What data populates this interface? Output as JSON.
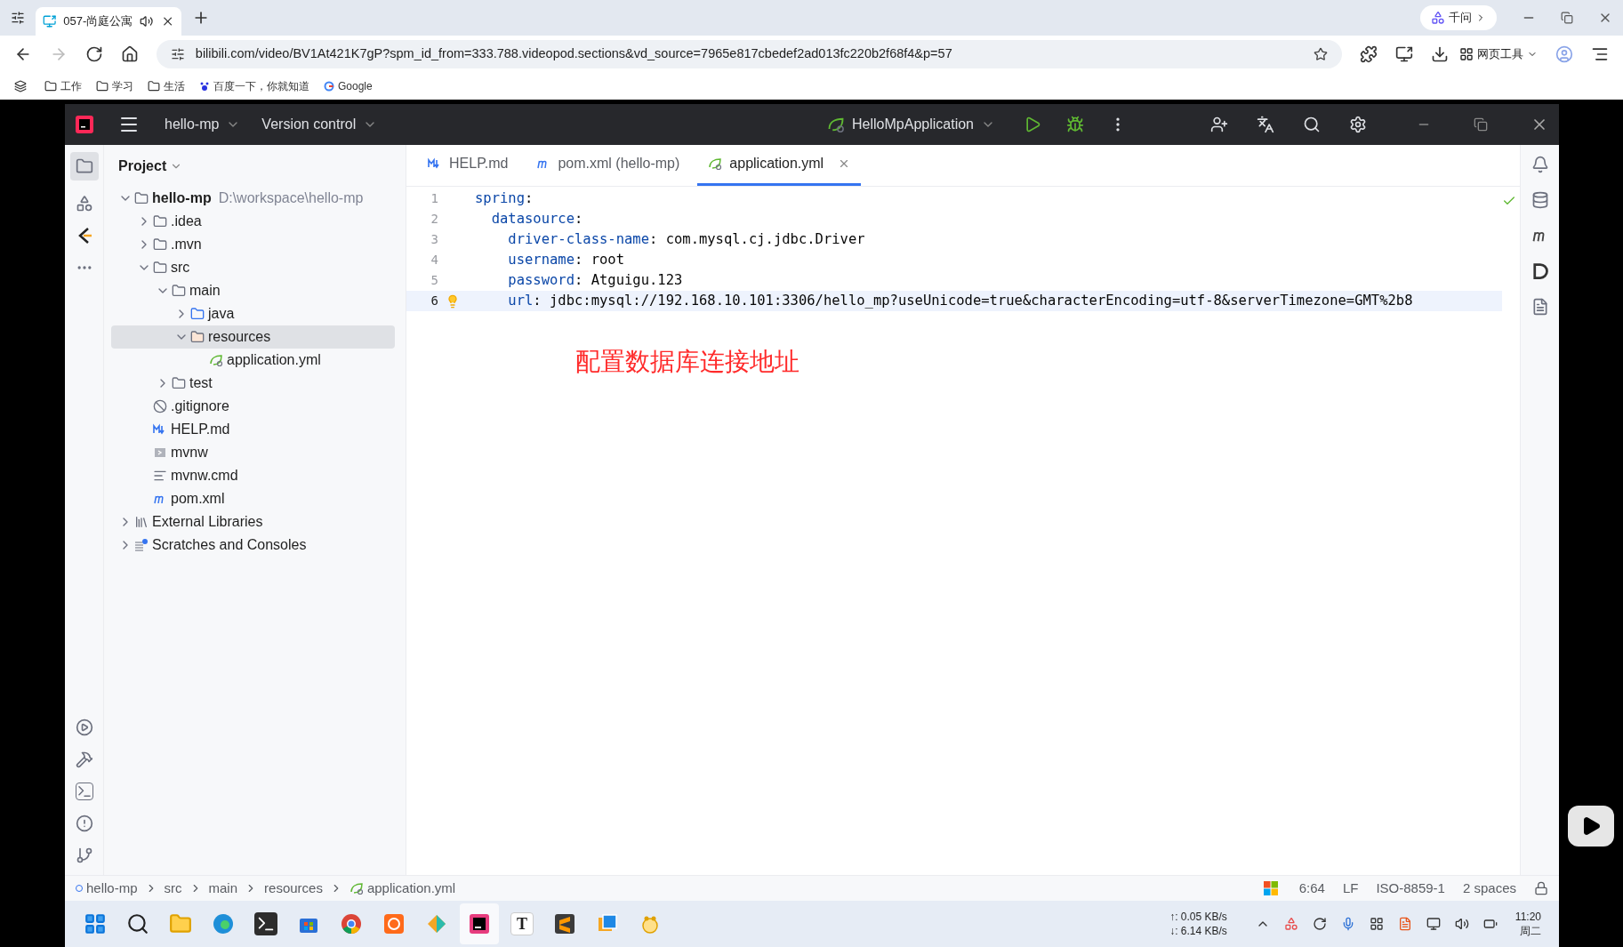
{
  "browser": {
    "tab": {
      "title": "057-尚庭公寓"
    },
    "url": "bilibili.com/video/BV1At421K7gP?spm_id_from=333.788.videopod.sections&vd_source=7965e817cbedef2ad013fc220b2f68f4&p=57",
    "assistant": "千问",
    "tools": "网页工具",
    "bookmarks": [
      {
        "label": "工作",
        "kind": "folder"
      },
      {
        "label": "学习",
        "kind": "folder"
      },
      {
        "label": "生活",
        "kind": "folder"
      },
      {
        "label": "百度一下，你就知道",
        "kind": "baidu"
      },
      {
        "label": "Google",
        "kind": "google"
      }
    ]
  },
  "ide": {
    "project": "hello-mp",
    "vcs": "Version control",
    "run_config": "HelloMpApplication",
    "panel_title": "Project",
    "tree": [
      {
        "name": "hello-mp",
        "path": "D:\\workspace\\hello-mp",
        "kind": "module",
        "expanded": true,
        "selected": false,
        "children": [
          {
            "name": ".idea",
            "kind": "folder",
            "expanded": false,
            "selected": false
          },
          {
            "name": ".mvn",
            "kind": "folder",
            "expanded": false,
            "selected": false
          },
          {
            "name": "src",
            "kind": "folder",
            "expanded": true,
            "selected": false,
            "children": [
              {
                "name": "main",
                "kind": "folder",
                "expanded": true,
                "selected": false,
                "children": [
                  {
                    "name": "java",
                    "kind": "source",
                    "expanded": false,
                    "selected": false
                  },
                  {
                    "name": "resources",
                    "kind": "resources",
                    "expanded": true,
                    "selected": true,
                    "children": [
                      {
                        "name": "application.yml",
                        "kind": "yaml",
                        "selected": false
                      }
                    ]
                  }
                ]
              },
              {
                "name": "test",
                "kind": "folder",
                "expanded": false,
                "selected": false
              }
            ]
          },
          {
            "name": ".gitignore",
            "kind": "ignore",
            "selected": false
          },
          {
            "name": "HELP.md",
            "kind": "markdown",
            "selected": false
          },
          {
            "name": "mvnw",
            "kind": "script",
            "selected": false
          },
          {
            "name": "mvnw.cmd",
            "kind": "text",
            "selected": false
          },
          {
            "name": "pom.xml",
            "kind": "maven",
            "selected": false
          }
        ]
      },
      {
        "name": "External Libraries",
        "kind": "libraries",
        "expanded": false,
        "selected": false
      },
      {
        "name": "Scratches and Consoles",
        "kind": "scratches",
        "expanded": false,
        "selected": false
      }
    ],
    "tabs": [
      {
        "label": "HELP.md",
        "kind": "markdown",
        "selected": false
      },
      {
        "label": "pom.xml (hello-mp)",
        "kind": "maven",
        "selected": false
      },
      {
        "label": "application.yml",
        "kind": "yaml",
        "selected": true
      }
    ],
    "code": [
      {
        "number": "1",
        "key": "spring",
        "value": ":",
        "current": false,
        "hint": false
      },
      {
        "number": "2",
        "key": "  datasource",
        "value": ":",
        "current": false,
        "hint": false
      },
      {
        "number": "3",
        "key": "    driver-class-name",
        "value": ": com.mysql.cj.jdbc.Driver",
        "current": false,
        "hint": false
      },
      {
        "number": "4",
        "key": "    username",
        "value": ": root",
        "current": false,
        "hint": false
      },
      {
        "number": "5",
        "key": "    password",
        "value": ": Atguigu.123",
        "current": false,
        "hint": false
      },
      {
        "number": "6",
        "key": "    url",
        "value": ": jdbc:mysql://192.168.10.101:3306/hello_mp?useUnicode=true&characterEncoding=utf-8&serverTimezone=GMT%2b8",
        "current": true,
        "hint": true
      }
    ],
    "annotation": "配置数据库连接地址",
    "breadcrumbs": [
      {
        "label": "hello-mp",
        "kind": "module"
      },
      {
        "label": "src",
        "kind": "folder"
      },
      {
        "label": "main",
        "kind": "folder"
      },
      {
        "label": "resources",
        "kind": "folder"
      },
      {
        "label": "application.yml",
        "kind": "yaml"
      }
    ],
    "status": {
      "position": "6:64",
      "line_separator": "LF",
      "encoding": "ISO-8859-1",
      "indent": "2 spaces"
    }
  },
  "taskbar": {
    "apps": [
      {
        "kind": "start"
      },
      {
        "kind": "search"
      },
      {
        "kind": "files"
      },
      {
        "kind": "edge"
      },
      {
        "kind": "terminal"
      },
      {
        "kind": "store"
      },
      {
        "kind": "chrome"
      },
      {
        "kind": "orange"
      },
      {
        "kind": "git"
      },
      {
        "kind": "idea"
      },
      {
        "kind": "letter",
        "label": "T"
      },
      {
        "kind": "sublime"
      },
      {
        "kind": "window"
      },
      {
        "kind": "paw"
      }
    ],
    "upload": "↑: 0.05 KB/s",
    "download": "↓: 6.14 KB/s",
    "time": "11:20",
    "day": "周二"
  }
}
